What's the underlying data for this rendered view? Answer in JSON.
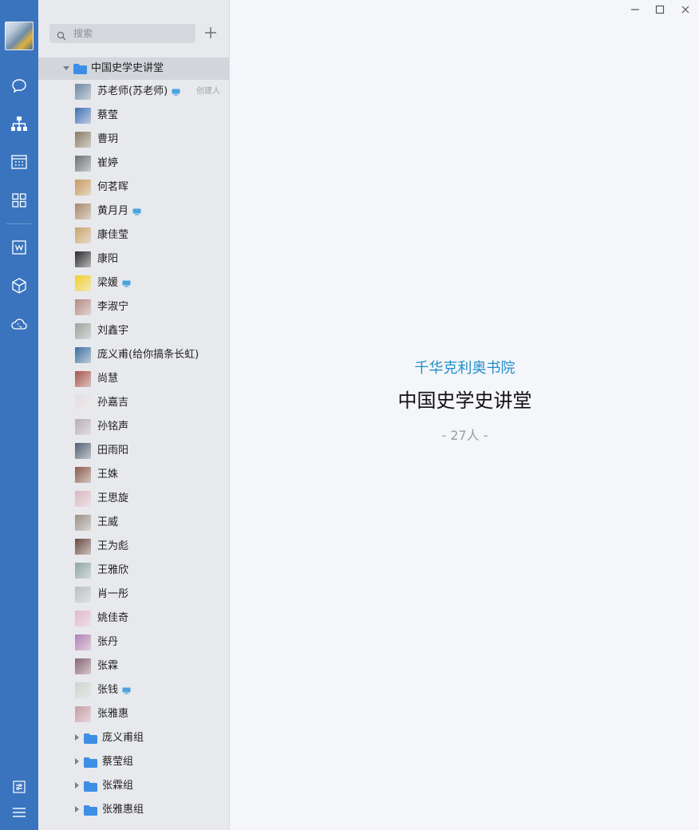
{
  "nav": {
    "icons": [
      "chat-icon",
      "org-chart-icon",
      "calendar-icon",
      "apps-grid-icon",
      "word-doc-icon",
      "cube-icon",
      "cloud-phone-icon",
      "settings-sliders-icon",
      "menu-icon"
    ]
  },
  "search": {
    "placeholder": "搜索"
  },
  "tree": {
    "root_label": "中国史学史讲堂",
    "members": [
      {
        "name": "苏老师(苏老师)",
        "pc": true,
        "role": "创建人",
        "color": "#6d86a3"
      },
      {
        "name": "蔡莹",
        "pc": false,
        "role": "",
        "color": "#3f6fb5"
      },
      {
        "name": "曹玥",
        "pc": false,
        "role": "",
        "color": "#8a7a63"
      },
      {
        "name": "崔婷",
        "pc": false,
        "role": "",
        "color": "#6a6f75"
      },
      {
        "name": "何茗晖",
        "pc": false,
        "role": "",
        "color": "#c79a5a"
      },
      {
        "name": "黄月月",
        "pc": true,
        "role": "",
        "color": "#a8876a"
      },
      {
        "name": "康佳莹",
        "pc": false,
        "role": "",
        "color": "#c9a46a"
      },
      {
        "name": "康阳",
        "pc": false,
        "role": "",
        "color": "#2a2a2a"
      },
      {
        "name": "梁媛",
        "pc": true,
        "role": "",
        "color": "#f2cf2d"
      },
      {
        "name": "李淑宁",
        "pc": false,
        "role": "",
        "color": "#b58a83"
      },
      {
        "name": "刘鑫宇",
        "pc": false,
        "role": "",
        "color": "#9aa39c"
      },
      {
        "name": "庞义甫(给你搞条长虹)",
        "pc": false,
        "role": "",
        "color": "#3b6e9e"
      },
      {
        "name": "尚慧",
        "pc": false,
        "role": "",
        "color": "#a8524a"
      },
      {
        "name": "孙嘉吉",
        "pc": false,
        "role": "",
        "color": "#e6dde0"
      },
      {
        "name": "孙铭声",
        "pc": false,
        "role": "",
        "color": "#b8aeb6"
      },
      {
        "name": "田雨阳",
        "pc": false,
        "role": "",
        "color": "#4f5f73"
      },
      {
        "name": "王姝",
        "pc": false,
        "role": "",
        "color": "#8a5a4a"
      },
      {
        "name": "王思旋",
        "pc": false,
        "role": "",
        "color": "#d9b8c0"
      },
      {
        "name": "王威",
        "pc": false,
        "role": "",
        "color": "#9b9085"
      },
      {
        "name": "王为彪",
        "pc": false,
        "role": "",
        "color": "#6a4a40"
      },
      {
        "name": "王雅欣",
        "pc": false,
        "role": "",
        "color": "#8fa6a0"
      },
      {
        "name": "肖一彤",
        "pc": false,
        "role": "",
        "color": "#b9bfc4"
      },
      {
        "name": "姚佳奇",
        "pc": false,
        "role": "",
        "color": "#e2b8c8"
      },
      {
        "name": "张丹",
        "pc": false,
        "role": "",
        "color": "#b07fb3"
      },
      {
        "name": "张霖",
        "pc": false,
        "role": "",
        "color": "#8a6470"
      },
      {
        "name": "张钱",
        "pc": true,
        "role": "",
        "color": "#cfd3cc"
      },
      {
        "name": "张雅惠",
        "pc": false,
        "role": "",
        "color": "#c59ca5"
      }
    ],
    "subgroups": [
      "庞义甫组",
      "蔡莹组",
      "张霖组",
      "张雅惠组"
    ]
  },
  "main": {
    "org_name": "千华克利奥书院",
    "group_title": "中国史学史讲堂",
    "member_count": "- 27人 -"
  },
  "colors": {
    "rail": "#3a74bf",
    "accent": "#1f8fc7",
    "folder": "#3d8fe6",
    "pc_badge": "#4aa3df"
  }
}
